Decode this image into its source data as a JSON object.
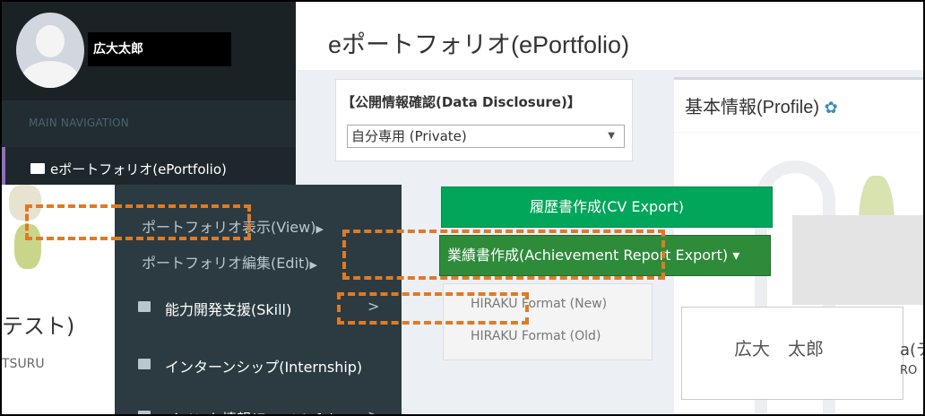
{
  "user": {
    "name": "広大太郎"
  },
  "sidebar": {
    "header": "MAIN NAVIGATION",
    "items": [
      {
        "label": "eポートフォリオ(ePortfolio)"
      }
    ],
    "submenu": [
      {
        "label": "ポートフォリオ表示(View)",
        "caret": "▶"
      },
      {
        "label": "ポートフォリオ編集(Edit)",
        "caret": "▶"
      },
      {
        "label": "能力開発支援(Skill)",
        "chevron": ">"
      },
      {
        "label": "インターンシップ(Internship)"
      },
      {
        "label": "イベント情報(Event Info)",
        "chevron": ">"
      }
    ]
  },
  "page": {
    "title": "eポートフォリオ(ePortfolio)"
  },
  "disclosure": {
    "title": "【公開情報確認(Data Disclosure)】",
    "selected": "自分専用 (Private)"
  },
  "buttons": {
    "cv_export": "履歴書作成(CV Export)",
    "achievement_export": "業績書作成(Achievement Report Export)",
    "achievement_caret": "▾"
  },
  "achievement_menu": [
    "HIRAKU Format (New)",
    "HIRAKU Format (Old)"
  ],
  "profile": {
    "title": "基本情報(Profile)",
    "name": "広大　太郎",
    "clipped_right": "a(テ",
    "clipped_right_sub": "RO"
  },
  "fragments": {
    "left_text": "テスト)",
    "left_sub": "TSURU"
  },
  "icons": [
    "user-avatar",
    "folder-icon",
    "gear-icon",
    "caret-right-icon",
    "chevron-right-icon",
    "caret-down-icon"
  ],
  "colors": {
    "sidebar_bg": "#222d32",
    "submenu_bg": "#2c3b41",
    "cv_button": "#00a65a",
    "achievement_button": "#2e8b3a",
    "annotation": "#e07a24",
    "gear": "#3c8dbc"
  }
}
